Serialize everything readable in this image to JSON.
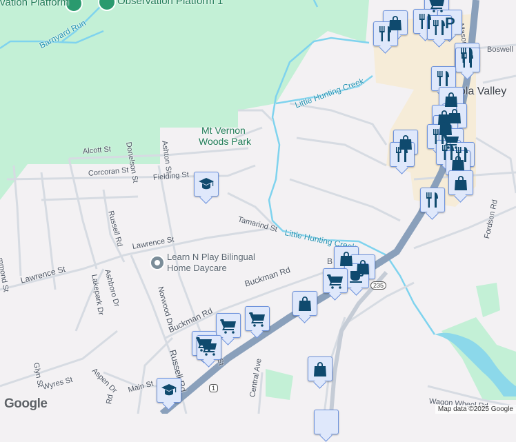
{
  "map": {
    "labels": {
      "observation_platform_left": "vation Platform",
      "observation_platform_1": "Observation Platform 1",
      "barnyard_run": "Barnyard Run",
      "little_hunting_creek_north": "Little Hunting Creek",
      "little_hunting_creek_south": "Little Hunting Creek",
      "mt_vernon_woods_park_1": "Mt Vernon",
      "mt_vernon_woods_park_2": "Woods Park",
      "alcott_st": "Alcott St",
      "corcoran_st": "Corcoran St",
      "donelson_st": "Donelson St",
      "ashton_st": "Ashton St",
      "fielding_st": "Fielding St",
      "russell_rd_north": "Russell Rd",
      "russell_rd_south": "Russell Rd",
      "russell_rd_bottom": "Rd",
      "lawrence_st_east": "Lawrence St",
      "lawrence_st_west": "Lawrence St",
      "hammond_st": "mmond St",
      "ashboro_dr": "Ashboro Dr",
      "lakepark_dr": "Lakepark Dr",
      "norwood_dr": "Norwood Dr",
      "daycare_1": "Learn N Play Bilingual",
      "daycare_2": "Home Daycare",
      "buckman_rd_east": "Buckman Rd",
      "buckman_rd_west": "Buckman Rd",
      "buckman_b": "B",
      "tamarind_st": "Tamarind St",
      "glyn_st": "Glyn St",
      "wyres_st": "Wyres St",
      "aspen_dr": "Aspen Dr",
      "main_st": "Main St",
      "central_ave": "Central Ave",
      "st_partial": "St",
      "wagon_wheel_rd": "Wagon Wheel Rd",
      "boswell": "Boswell",
      "mason": "Mason",
      "hybla_valley": "ola Valley",
      "fordson_rd": "Fordson Rd"
    },
    "shields": {
      "route_235": "235",
      "route_1": "1"
    },
    "attribution": "Map data ©2025 Google",
    "logo": "Google",
    "colors": {
      "park": "#c3f0d6",
      "water": "#7fd3ee",
      "commercial": "#f6ecd8",
      "highway": "#8aa0bb",
      "pin_icon": "#0f4a6e"
    }
  }
}
